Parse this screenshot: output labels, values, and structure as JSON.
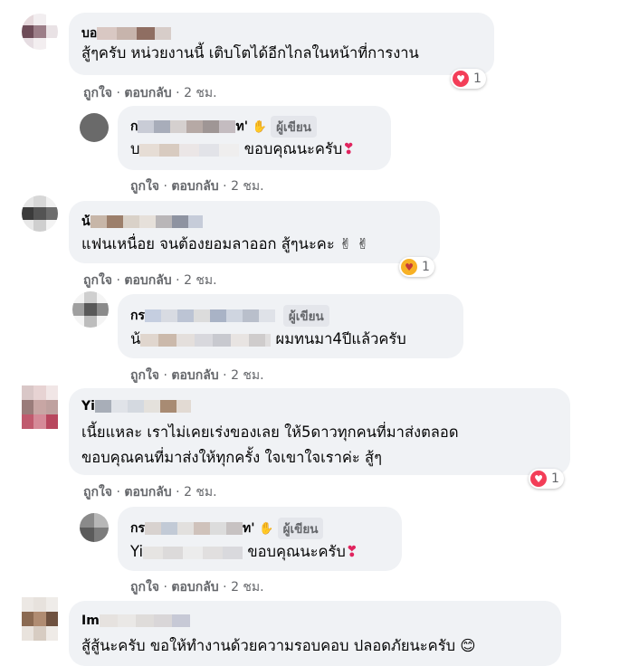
{
  "comments": [
    {
      "name": "บอ",
      "text_lines": [
        "สู้ๆครับ หน่วยงานนี้ เติบโตได้อีกไกลในหน้าที่การงาน"
      ],
      "reaction": {
        "type": "heart",
        "count": "1"
      },
      "actions": {
        "like": "ถูกใจ",
        "reply": "ตอบกลับ",
        "time": "2 ชม."
      },
      "reply": {
        "name": "ก",
        "name_suffix": "ท'",
        "author_badge": "ผู้เขียน",
        "mention": "บ",
        "text": "ขอบคุณนะครับ",
        "actions": {
          "like": "ถูกใจ",
          "reply": "ตอบกลับ",
          "time": "2 ชม."
        }
      }
    },
    {
      "name": "น้",
      "text_lines": [
        "แฟนเหนื่อย จนต้องยอมลาออก สู้ๆนะคะ ✌ ✌"
      ],
      "reaction": {
        "type": "care",
        "count": "1"
      },
      "actions": {
        "like": "ถูกใจ",
        "reply": "ตอบกลับ",
        "time": "2 ชม."
      },
      "reply": {
        "name": "กร",
        "author_badge": "ผู้เขียน",
        "mention": "น้",
        "text": "ผมทนมา4ปีแล้วครับ",
        "actions": {
          "like": "ถูกใจ",
          "reply": "ตอบกลับ",
          "time": "2 ชม."
        }
      }
    },
    {
      "name": "Yi",
      "text_lines": [
        "เนี้ยแหละ เราไม่เคยเร่งของเลย ให้5ดาวทุกคนที่มาส่งตลอด",
        "ขอบคุณคนที่มาส่งให้ทุกครั้ง ใจเขาใจเราค่ะ สู้ๆ"
      ],
      "reaction": {
        "type": "heart",
        "count": "1"
      },
      "actions": {
        "like": "ถูกใจ",
        "reply": "ตอบกลับ",
        "time": "2 ชม."
      },
      "reply": {
        "name": "กร",
        "name_suffix": "ท'",
        "author_badge": "ผู้เขียน",
        "mention": "Yi",
        "text": "ขอบคุณนะครับ",
        "actions": {
          "like": "ถูกใจ",
          "reply": "ตอบกลับ",
          "time": "2 ชม."
        }
      }
    },
    {
      "name": "Im",
      "text_lines": [
        "สู้สู้นะครับ ขอให้ทำงานด้วยความรอบคอบ ปลอดภัยนะครับ 😊"
      ]
    }
  ],
  "colors": {
    "bubble": "#f0f2f5",
    "heart": "#f33e58",
    "meta": "#65676b"
  }
}
